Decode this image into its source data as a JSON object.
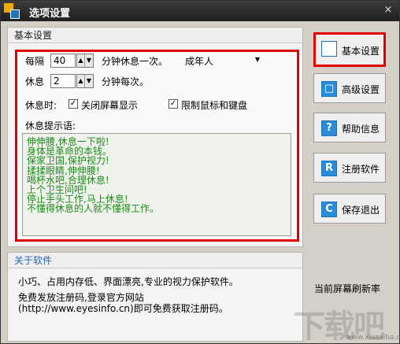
{
  "window": {
    "title": "选项设置",
    "close": "×"
  },
  "basic": {
    "header": "基本设置",
    "interval_label": "每隔",
    "interval_value": "40",
    "interval_suffix": "分钟休息一次。",
    "profile_value": "成年人",
    "rest_label": "休息",
    "rest_value": "2",
    "rest_suffix": "分钟每次。",
    "rest_when_label": "休息时:",
    "cb_close_screen": {
      "label": "关闭屏幕显示",
      "checked": "✓"
    },
    "cb_lock_input": {
      "label": "限制鼠标和键盘",
      "checked": "✓"
    },
    "tips_label": "休息提示语:",
    "tips": [
      "伸伸腰,休息一下啦!",
      "身体是革命的本钱。",
      "保家卫国,保护视力!",
      "揉揉眼睛,伸伸腰!",
      "喝杯水吧,合理休息!",
      "上个卫生间吧!",
      "停止手头工作,马上休息!",
      "不懂得休息的人就不懂得工作。"
    ]
  },
  "side": {
    "basic": {
      "icon": "",
      "label": "基本设置"
    },
    "advanced": {
      "icon": "□",
      "label": "高级设置"
    },
    "help": {
      "icon": "?",
      "label": "帮助信息"
    },
    "register": {
      "icon": "R",
      "label": "注册软件"
    },
    "save_exit": {
      "icon": "C",
      "label": "保存退出"
    }
  },
  "about": {
    "header": "关于软件",
    "line1": "小巧、占用内存低、界面漂亮,专业的视力保护软件。",
    "line2": "免费发放注册码,登录官方网站",
    "line3": "(http://www.eyesinfo.cn)即可免费获取注册码。"
  },
  "status": "当前屏幕刷新率",
  "watermark": {
    "big": "下载吧",
    "small": "www.xiazaiba.com"
  },
  "colors": {
    "accent": "#1e73be",
    "highlight": "#e00000",
    "tips_text": "#1a8a1a",
    "about_header": "#2a63b5"
  }
}
